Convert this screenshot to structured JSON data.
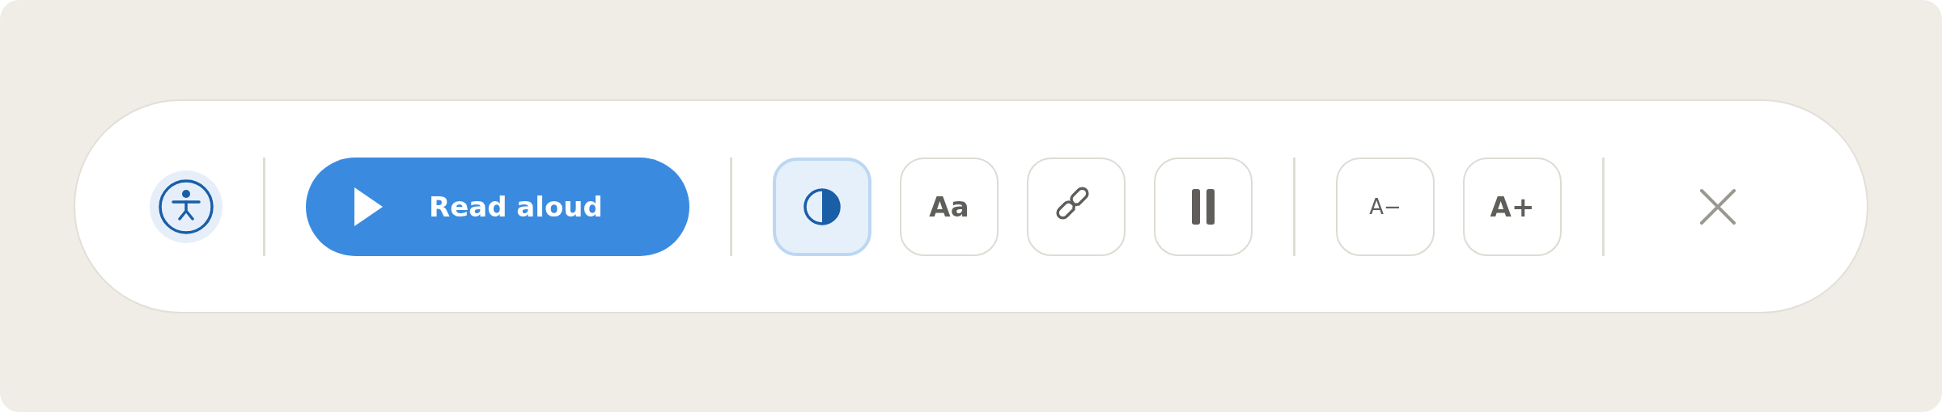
{
  "toolbar": {
    "read_aloud": {
      "label": "Read aloud"
    },
    "tools": [
      {
        "kind": "contrast",
        "on": true
      },
      {
        "kind": "font",
        "label": "Aa",
        "on": false
      },
      {
        "kind": "links",
        "on": false
      },
      {
        "kind": "pause",
        "on": false
      }
    ],
    "size_buttons": [
      {
        "kind": "decrease",
        "label": "A−"
      },
      {
        "kind": "increase",
        "label": "A+"
      }
    ]
  }
}
